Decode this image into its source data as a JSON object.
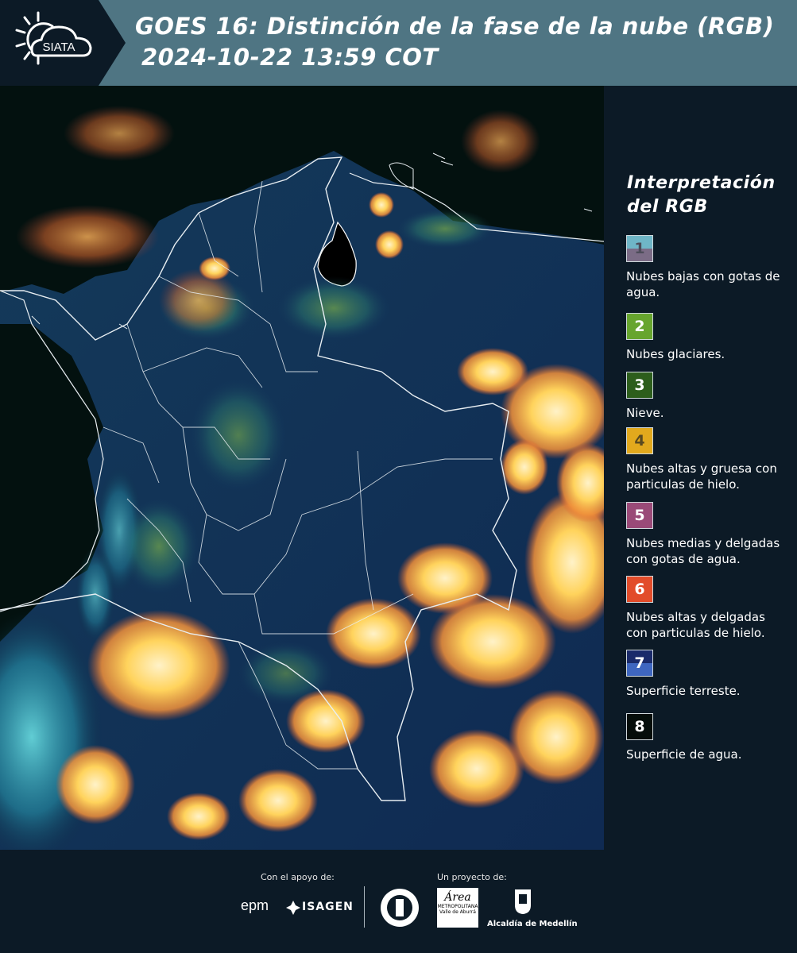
{
  "header": {
    "logo_text": "SIATA",
    "title_line1": "GOES 16: Distinción de la fase de la nube (RGB)",
    "title_line2": "2024-10-22 13:59 COT"
  },
  "legend": {
    "title_line1": "Interpretación",
    "title_line2": "del RGB",
    "items": [
      {
        "number": "1",
        "label": "Nubes bajas con gotas de agua.",
        "color_top": "#6fb6c7",
        "color_bottom": "#7b6c86",
        "text_color": "#4d4d5a"
      },
      {
        "number": "2",
        "label": "Nubes glaciares.",
        "color_top": "#67a52e",
        "color_bottom": "#67a52e",
        "text_color": "#ffffff"
      },
      {
        "number": "3",
        "label": "Nieve.",
        "color_top": "#2d5e1c",
        "color_bottom": "#2d5e1c",
        "text_color": "#ffffff"
      },
      {
        "number": "4",
        "label": "Nubes altas y gruesa con particulas de hielo.",
        "color_top": "#e2a91d",
        "color_bottom": "#e2a91d",
        "text_color": "#5a4a20"
      },
      {
        "number": "5",
        "label": "Nubes medias y delgadas con gotas de agua.",
        "color_top": "#9a4a78",
        "color_bottom": "#9a4a78",
        "text_color": "#ffffff"
      },
      {
        "number": "6",
        "label": "Nubes altas y delgadas con particulas de hielo.",
        "color_top": "#e24c2a",
        "color_bottom": "#e24c2a",
        "text_color": "#ffffff"
      },
      {
        "number": "7",
        "label": "Superficie terreste.",
        "color_top": "#1a2a6a",
        "color_bottom": "#3e66c0",
        "text_color": "#ffffff"
      },
      {
        "number": "8",
        "label": "Superficie de agua.",
        "color_top": "#050d0a",
        "color_bottom": "#050d0a",
        "text_color": "#ffffff"
      }
    ]
  },
  "footer": {
    "support_label": "Con el apoyo de:",
    "project_label": "Un proyecto de:",
    "sponsor1": "epm",
    "sponsor2": "ISAGEN",
    "partner1": "Área",
    "partner1_sub": "METROPOLITANA",
    "partner1_sub2": "Valle de Aburrá",
    "partner2": "Alcaldía de Medellín"
  }
}
